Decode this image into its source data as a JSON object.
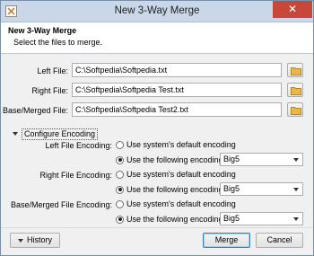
{
  "window": {
    "title": "New 3-Way Merge",
    "icon": "merge-app-icon",
    "close_label": "✕"
  },
  "header": {
    "title": "New 3-Way Merge",
    "subtitle": "Select the files to merge."
  },
  "files": [
    {
      "label": "Left File:",
      "value": "C:\\Softpedia\\Softpedia.txt"
    },
    {
      "label": "Right File:",
      "value": "C:\\Softpedia\\Softpedia Test.txt"
    },
    {
      "label": "Base/Merged File:",
      "value": "C:\\Softpedia\\Softpedia Test2.txt"
    }
  ],
  "encoding": {
    "section_label": "Configure Encoding",
    "expanded": true,
    "rows": [
      {
        "label": "Left File Encoding:",
        "default_option": "Use system's default encoding",
        "custom_option": "Use the following encoding:",
        "selected": "custom",
        "value": "Big5"
      },
      {
        "label": "Right File Encoding:",
        "default_option": "Use system's default encoding",
        "custom_option": "Use the following encoding:",
        "selected": "custom",
        "value": "Big5"
      },
      {
        "label": "Base/Merged File Encoding:",
        "default_option": "Use system's default encoding",
        "custom_option": "Use the following encoding:",
        "selected": "custom",
        "value": "Big5"
      }
    ]
  },
  "footer": {
    "history_label": "History",
    "merge_label": "Merge",
    "cancel_label": "Cancel"
  },
  "colors": {
    "titlebar": "#c9d7e8",
    "close_button": "#c7473b",
    "folder_icon": "#e8b84a",
    "default_button_border": "#3c7fb1"
  }
}
